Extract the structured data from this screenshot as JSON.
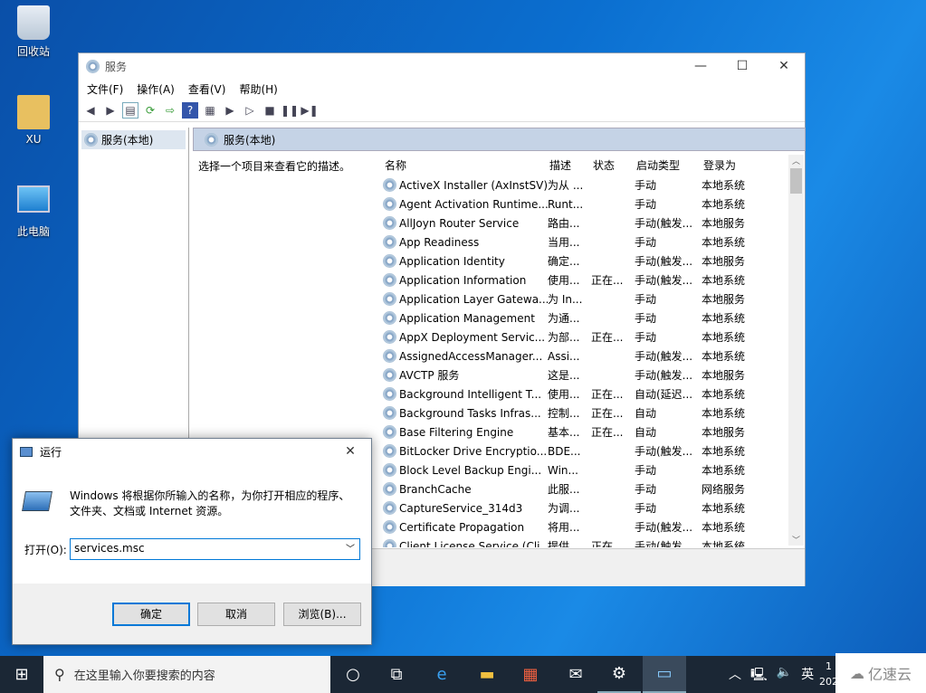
{
  "desktop": {
    "icons": [
      {
        "label": "回收站",
        "icon": "recycle-bin-icon"
      },
      {
        "label": "XU",
        "icon": "user-folder-icon"
      },
      {
        "label": "此电脑",
        "icon": "computer-icon"
      }
    ]
  },
  "services": {
    "title": "服务",
    "menu": [
      "文件(F)",
      "操作(A)",
      "查看(V)",
      "帮助(H)"
    ],
    "tree_item": "服务(本地)",
    "header": "服务(本地)",
    "description_prompt": "选择一个项目来查看它的描述。",
    "columns": [
      "名称",
      "描述",
      "状态",
      "启动类型",
      "登录为"
    ],
    "rows": [
      [
        "ActiveX Installer (AxInstSV)",
        "为从 ...",
        "",
        "手动",
        "本地系统"
      ],
      [
        "Agent Activation Runtime...",
        "Runt...",
        "",
        "手动",
        "本地系统"
      ],
      [
        "AllJoyn Router Service",
        "路由...",
        "",
        "手动(触发...",
        "本地服务"
      ],
      [
        "App Readiness",
        "当用...",
        "",
        "手动",
        "本地系统"
      ],
      [
        "Application Identity",
        "确定...",
        "",
        "手动(触发...",
        "本地服务"
      ],
      [
        "Application Information",
        "使用...",
        "正在...",
        "手动(触发...",
        "本地系统"
      ],
      [
        "Application Layer Gatewa...",
        "为 In...",
        "",
        "手动",
        "本地服务"
      ],
      [
        "Application Management",
        "为通...",
        "",
        "手动",
        "本地系统"
      ],
      [
        "AppX Deployment Servic...",
        "为部...",
        "正在...",
        "手动",
        "本地系统"
      ],
      [
        "AssignedAccessManager...",
        "Assi...",
        "",
        "手动(触发...",
        "本地系统"
      ],
      [
        "AVCTP 服务",
        "这是...",
        "",
        "手动(触发...",
        "本地服务"
      ],
      [
        "Background Intelligent T...",
        "使用...",
        "正在...",
        "自动(延迟...",
        "本地系统"
      ],
      [
        "Background Tasks Infras...",
        "控制...",
        "正在...",
        "自动",
        "本地系统"
      ],
      [
        "Base Filtering Engine",
        "基本...",
        "正在...",
        "自动",
        "本地服务"
      ],
      [
        "BitLocker Drive Encryptio...",
        "BDE...",
        "",
        "手动(触发...",
        "本地系统"
      ],
      [
        "Block Level Backup Engi...",
        "Win...",
        "",
        "手动",
        "本地系统"
      ],
      [
        "BranchCache",
        "此服...",
        "",
        "手动",
        "网络服务"
      ],
      [
        "CaptureService_314d3",
        "为调...",
        "",
        "手动",
        "本地系统"
      ],
      [
        "Certificate Propagation",
        "将用...",
        "",
        "手动(触发...",
        "本地系统"
      ],
      [
        "Client License Service (Cli...",
        "提供...",
        "正在...",
        "手动(触发...",
        "本地系统"
      ]
    ]
  },
  "run": {
    "title": "运行",
    "description": "Windows 将根据你所输入的名称，为你打开相应的程序、文件夹、文档或 Internet 资源。",
    "open_label": "打开(O):",
    "input_value": "services.msc",
    "ok": "确定",
    "cancel": "取消",
    "browse": "浏览(B)..."
  },
  "taskbar": {
    "search_placeholder": "在这里输入你要搜索的内容",
    "ime": "英",
    "clock_partial": "1",
    "date_partial": "202"
  },
  "watermark": "亿速云"
}
